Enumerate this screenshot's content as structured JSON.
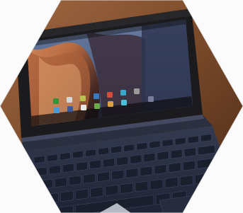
{
  "image": {
    "subject": "tablet-with-keyboard-dock",
    "colors": {
      "frame_background": "#f7f7f7",
      "wood_table": "#7a4a2a",
      "bezel": "#1b1b1d",
      "keyboard_body": "#2b3142",
      "key": "#1c2233",
      "wallpaper_warm": "#c47a4a",
      "wallpaper_dark": "#3a1e18",
      "wallpaper_sky": "#5a6a8a"
    },
    "icons": [
      "app-icon",
      "app-icon",
      "app-icon",
      "app-icon",
      "app-icon",
      "app-icon",
      "app-icon",
      "app-icon",
      "app-icon",
      "app-icon",
      "app-icon",
      "app-icon",
      "app-icon",
      "app-icon"
    ]
  },
  "screen": {
    "widget_line_1": "",
    "widget_line_2": ""
  }
}
